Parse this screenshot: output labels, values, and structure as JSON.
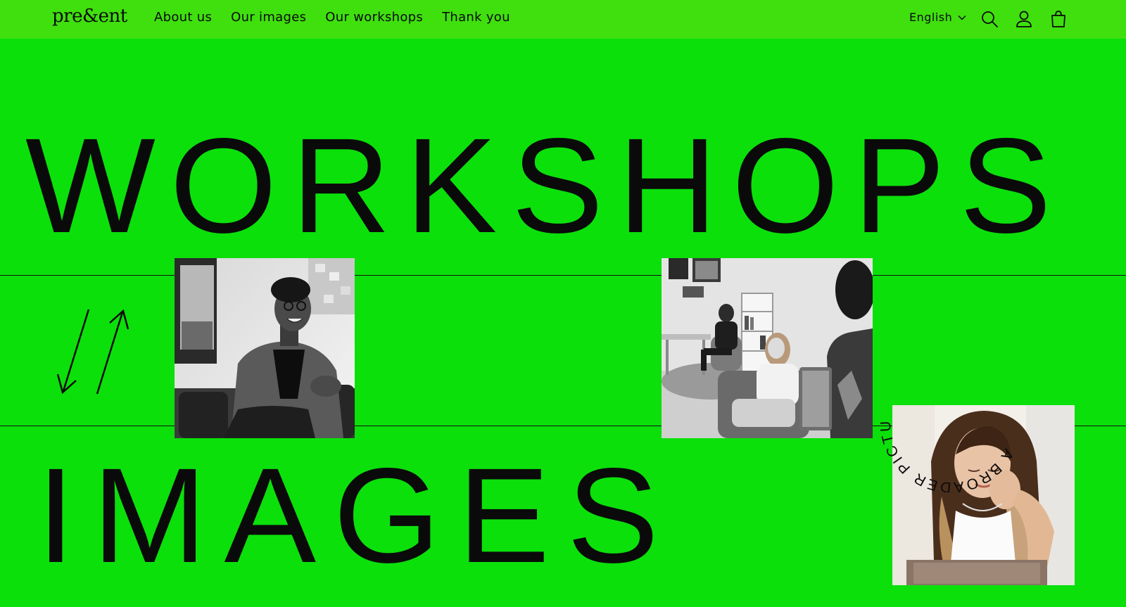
{
  "header": {
    "logo": "pre&ent",
    "nav": [
      {
        "label": "About us"
      },
      {
        "label": "Our images"
      },
      {
        "label": "Our workshops"
      },
      {
        "label": "Thank you"
      }
    ],
    "language": "English",
    "icons": [
      "search-icon",
      "account-icon",
      "cart-icon"
    ]
  },
  "hero": {
    "line1": "WORKSHOPS",
    "line2": "IMAGES",
    "badge_text": "A BROADER PICTURE"
  },
  "colors": {
    "background": "#0be00b",
    "header": "#3fe00e",
    "text": "#0a0a0a"
  }
}
